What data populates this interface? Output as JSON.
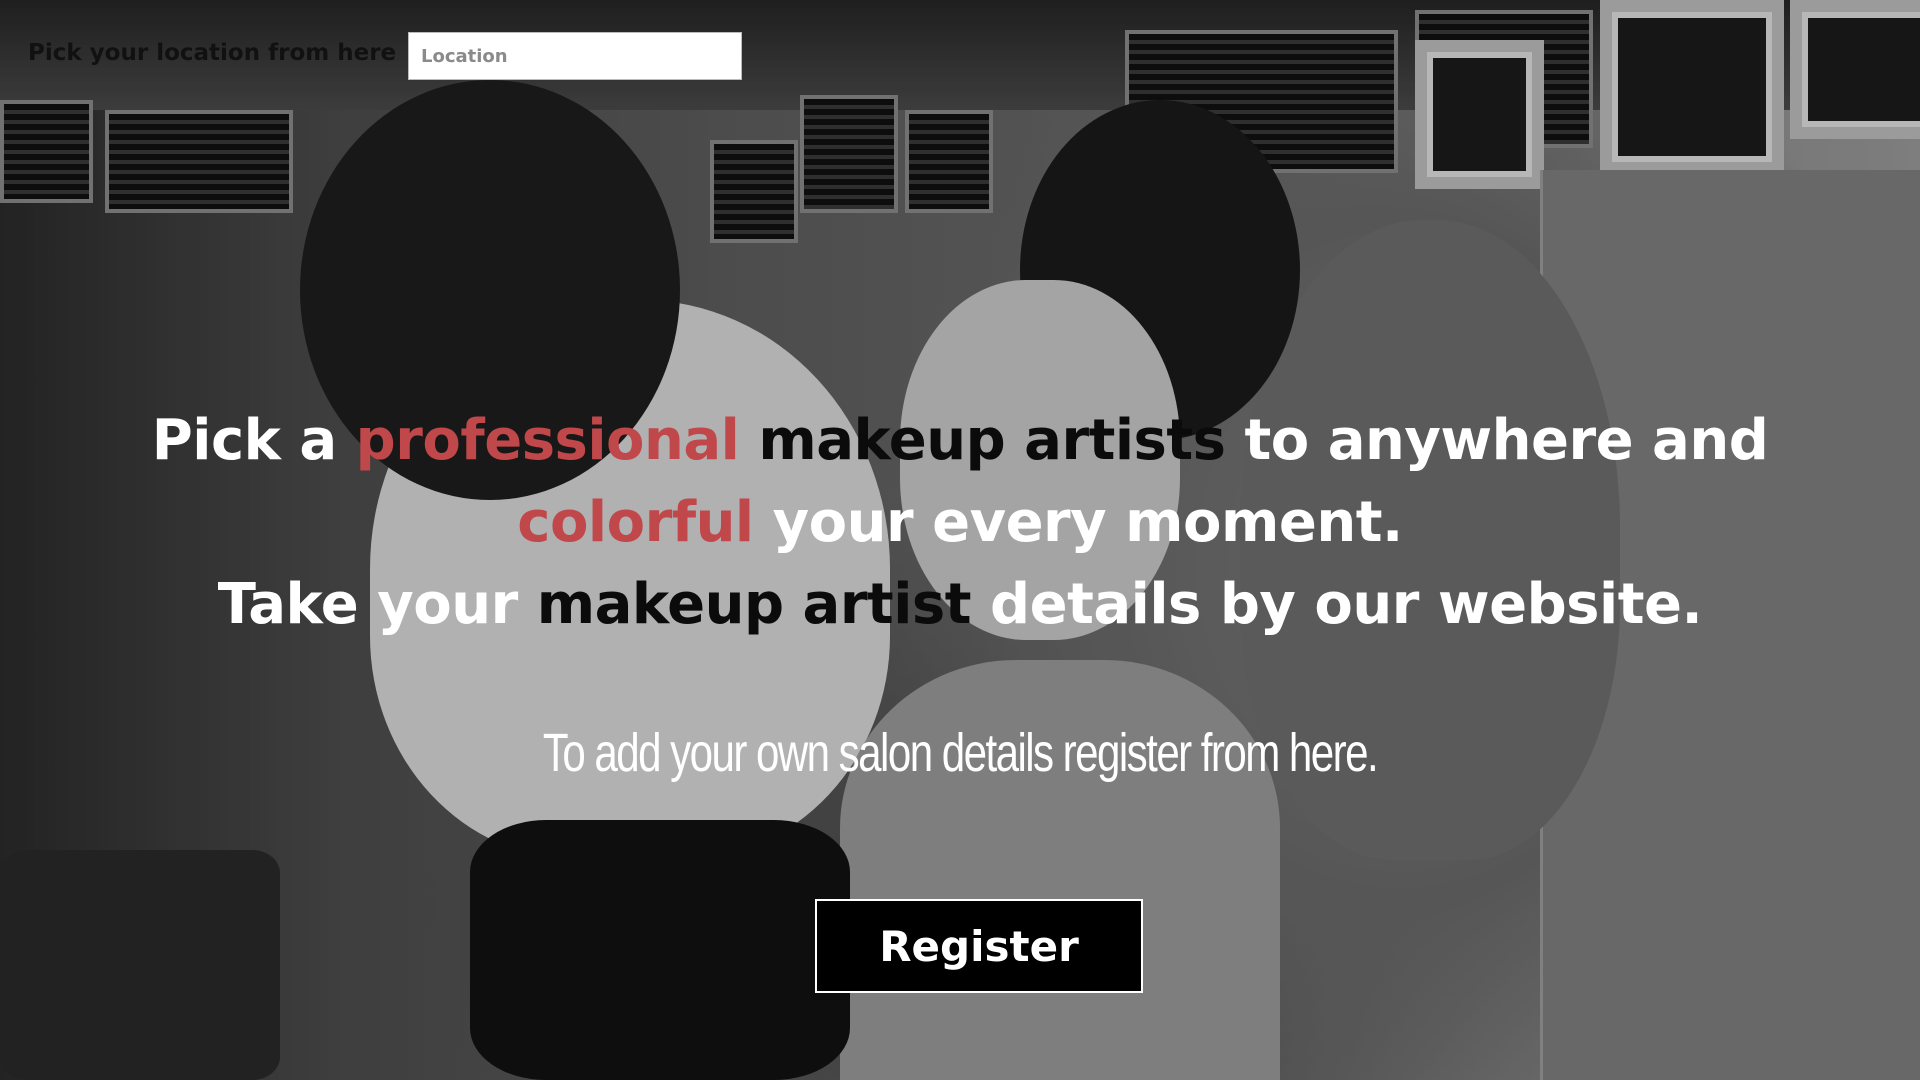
{
  "location_bar": {
    "label": "Pick your location from here",
    "input_value": "",
    "input_placeholder": "Location"
  },
  "hero": {
    "line1": {
      "part1": "Pick a ",
      "part2": "professional",
      "part3": " makeup artists",
      "part4": " to anywhere  and"
    },
    "line2": {
      "part1": "colorful",
      "part2": " your every moment."
    },
    "line3": {
      "part1": "Take your ",
      "part2": "makeup artist",
      "part3": " details by our website."
    }
  },
  "sub_text": "To add your own salon details register from here.",
  "register_button": {
    "label": "Register"
  },
  "colors": {
    "accent": "#c0474a",
    "button_bg": "#000000",
    "hero_text": "#ffffff"
  }
}
